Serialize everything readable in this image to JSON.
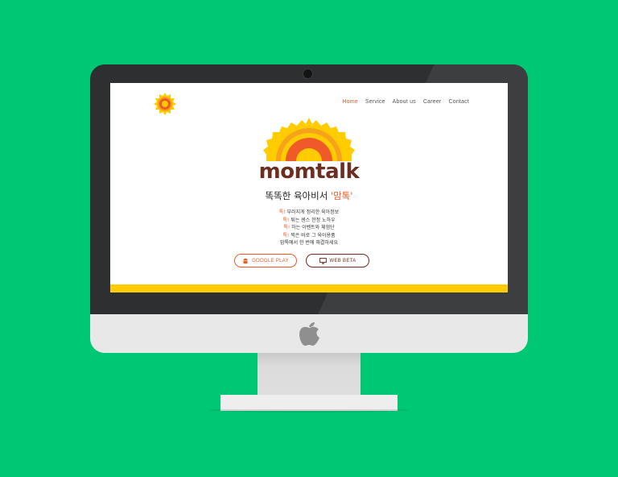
{
  "colors": {
    "background": "#00c774",
    "accent": "#f05a28",
    "brand_brown": "#6b2f22",
    "sun_yellow": "#ffcc00"
  },
  "nav": {
    "items": [
      {
        "label": "Home",
        "active": true
      },
      {
        "label": "Service",
        "active": false
      },
      {
        "label": "About us",
        "active": false
      },
      {
        "label": "Career",
        "active": false
      },
      {
        "label": "Contact",
        "active": false
      }
    ]
  },
  "hero": {
    "brand": "momtalk",
    "tagline_prefix": "똑똑한 육아비서 ",
    "tagline_highlight": "'맘톡'",
    "features": [
      {
        "key": "톡!",
        "text": " 부러지게 정리한 육아정보"
      },
      {
        "key": "톡!",
        "text": " 튀는 센스 한정 노하우"
      },
      {
        "key": "톡!",
        "text": " 하는 이벤트와 체험단"
      },
      {
        "key": "톡!",
        "text": " 찍은 바로 그 육아용품"
      }
    ],
    "closing": "맘톡에서 한 번에 해결하세요"
  },
  "buttons": {
    "google_play": {
      "label": "GOOGLE PLAY",
      "icon": "android-icon"
    },
    "web_beta": {
      "label": "WEB BETA",
      "icon": "monitor-icon"
    }
  }
}
